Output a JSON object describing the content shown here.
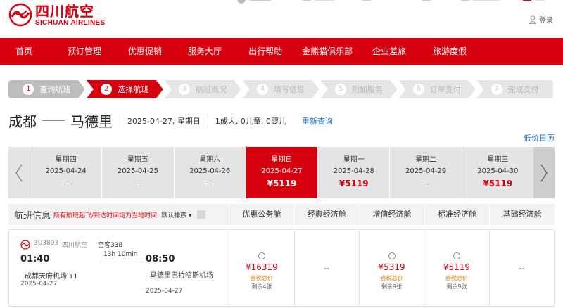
{
  "header": {
    "logo_cn": "四川航空",
    "logo_en": "SICHUAN AIRLINES",
    "login": "登录"
  },
  "nav": [
    "首页",
    "预订管理",
    "优惠促销",
    "服务大厅",
    "出行帮助",
    "金熊猫俱乐部",
    "企业差旅",
    "旅游度假"
  ],
  "steps": [
    {
      "num": "1",
      "label": "查询航班",
      "state": "done"
    },
    {
      "num": "2",
      "label": "选择航班",
      "state": "active"
    },
    {
      "num": "3",
      "label": "航班概况",
      "state": "todo"
    },
    {
      "num": "4",
      "label": "填写信息",
      "state": "todo"
    },
    {
      "num": "5",
      "label": "附加服务",
      "state": "todo"
    },
    {
      "num": "6",
      "label": "订单支付",
      "state": "todo"
    },
    {
      "num": "7",
      "label": "完成支付",
      "state": "todo"
    }
  ],
  "route": {
    "from": "成都",
    "to": "马德里",
    "date": "2025-04-27, 星期日",
    "passengers": "1成人, 0儿童, 0婴儿",
    "requery": "重新查询",
    "calendar_link": "低价日历"
  },
  "dates": [
    {
      "week": "星期四",
      "date": "2025-04-24",
      "price": "--"
    },
    {
      "week": "星期五",
      "date": "2025-04-25",
      "price": "--"
    },
    {
      "week": "星期六",
      "date": "2025-04-26",
      "price": "--"
    },
    {
      "week": "星期日",
      "date": "2025-04-27",
      "price": "¥5119"
    },
    {
      "week": "星期一",
      "date": "2025-04-28",
      "price": "¥5119"
    },
    {
      "week": "星期二",
      "date": "2025-04-29",
      "price": "--"
    },
    {
      "week": "星期三",
      "date": "2025-04-30",
      "price": "¥5119"
    }
  ],
  "table": {
    "title": "航班信息",
    "tip": "所有航班起飞/到达时间均为当地时间",
    "sort": "默认排序",
    "cabins": [
      "优惠公务舱",
      "经典经济舱",
      "增值经济舱",
      "标准经济舱",
      "基础经济舱"
    ]
  },
  "flight": {
    "number": "3U3803",
    "airline": "四川航空",
    "aircraft": "空客33B",
    "dep_time": "01:40",
    "arr_time": "08:50",
    "duration": "13h 10min",
    "dep_airport": "成都天府机场  T1",
    "arr_airport": "马德里巴拉哈斯机场",
    "dep_date": "2025-04-27",
    "arr_date": "2025-04-27",
    "fares": [
      {
        "price": "¥16319",
        "tax": "含税总价",
        "remain": "剩余4张"
      },
      {
        "price": "--"
      },
      {
        "price": "¥5319",
        "tax": "含税总价",
        "remain": "剩余9张"
      },
      {
        "price": "¥5119",
        "tax": "含税总价",
        "remain": "剩余9张"
      },
      {
        "price": "--"
      }
    ]
  },
  "colors": {
    "brand": "#d7000f",
    "link": "#1d6fc7"
  }
}
